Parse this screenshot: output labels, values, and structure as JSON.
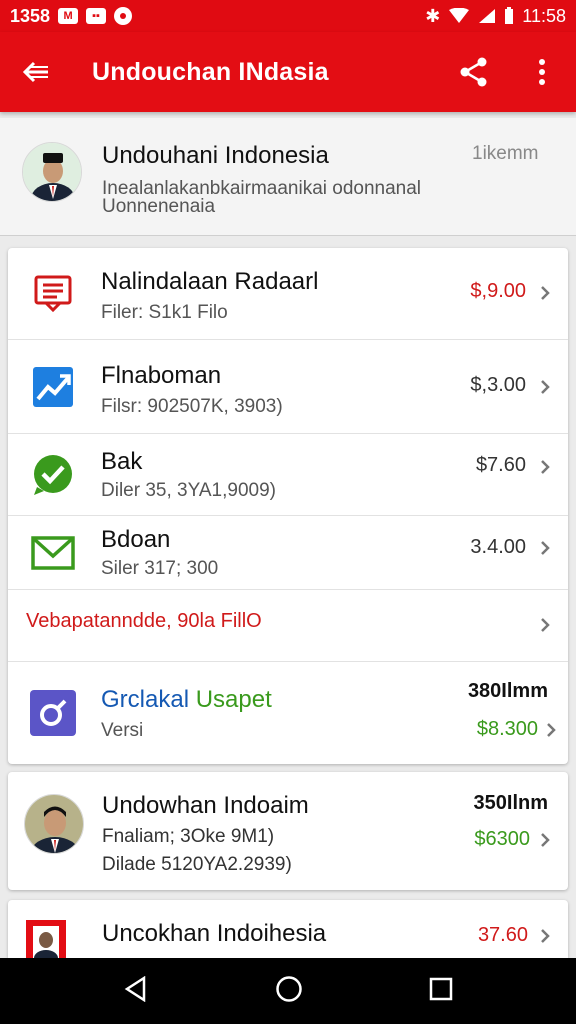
{
  "status": {
    "time_left": "1358",
    "time_right": "11:58"
  },
  "app_bar": {
    "title": "Undouchan INdasia"
  },
  "header": {
    "name": "Undouhani Indonesia",
    "meta": "1ikemm",
    "description": "Inealanlakanbkairmaanikai odonnanal Uonnenenaia"
  },
  "items": [
    {
      "title": "Nalindalaan Radaarl",
      "subtitle": "Filer: S1k1 Filo",
      "price": "$,9.00",
      "price_color": "#d01a1a",
      "icon": "receipt-icon"
    },
    {
      "title": "Flnaboman",
      "subtitle": "Filsr: 902507K, 3903)",
      "price": "$,3.00",
      "price_color": "#333333",
      "icon": "chart-trend-icon"
    },
    {
      "title": "Bak",
      "subtitle": "Diler 35, 3YA1,9009)",
      "price": "$7.60",
      "price_color": "#333333",
      "icon": "check-chat-icon"
    },
    {
      "title": "Bdoan",
      "subtitle": "Siler 317; 300",
      "price": "3.4.00",
      "price_color": "#333333",
      "icon": "mail-icon"
    }
  ],
  "notice": {
    "text": "Vebapatanndde, 90la FillO"
  },
  "featured": {
    "title_part1": "Grclakal",
    "title_part2": "Usapet",
    "subtitle": "Versi",
    "meta": "380Ilmm",
    "price": "$8.300"
  },
  "person_card": {
    "name": "Undowhan Indoaim",
    "line1": "Fnaliam; 3Oke 9M1)",
    "line2": "Dilade 5120YA2.2939)",
    "meta": "350Ilnm",
    "price": "$6300"
  },
  "last_card": {
    "name": "Uncokhan Indoihesia",
    "price": "37.60"
  },
  "colors": {
    "primary": "#e30d14",
    "accent_red": "#d01a1a",
    "accent_green": "#3a9a1d",
    "accent_blue": "#1559b3"
  }
}
